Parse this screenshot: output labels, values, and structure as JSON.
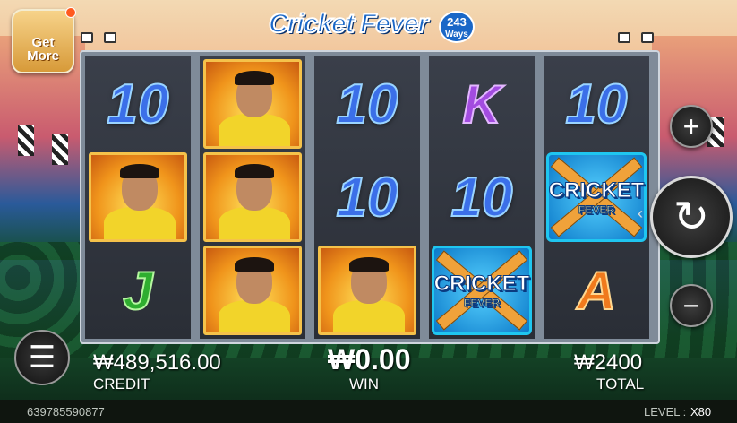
{
  "logo": {
    "title": "Cricket Fever",
    "ways_number": "243",
    "ways_label": "Ways"
  },
  "get_more": {
    "label_line1": "Get",
    "label_line2": "More"
  },
  "reels": [
    [
      {
        "type": "ten",
        "text": "10"
      },
      {
        "type": "captain"
      },
      {
        "type": "J",
        "text": "J"
      }
    ],
    [
      {
        "type": "captain"
      },
      {
        "type": "captain"
      },
      {
        "type": "captain"
      }
    ],
    [
      {
        "type": "ten",
        "text": "10"
      },
      {
        "type": "ten",
        "text": "10"
      },
      {
        "type": "captain"
      }
    ],
    [
      {
        "type": "K",
        "text": "K"
      },
      {
        "type": "ten",
        "text": "10"
      },
      {
        "type": "wild",
        "text1": "CRICKET",
        "text2": "FEVER"
      }
    ],
    [
      {
        "type": "ten",
        "text": "10"
      },
      {
        "type": "wild",
        "text1": "CRICKET",
        "text2": "FEVER"
      },
      {
        "type": "A",
        "text": "A"
      }
    ]
  ],
  "controls": {
    "plus_icon": "+",
    "minus_icon": "−",
    "spin_icon": "↻",
    "menu_icon": "☰",
    "collapse_icon": "‹"
  },
  "credit": {
    "value": "₩489,516.00",
    "label": "CREDIT"
  },
  "win": {
    "value": "₩0.00",
    "label": "WIN"
  },
  "total": {
    "value": "₩2400",
    "label": "TOTAL"
  },
  "footer": {
    "round_id": "639785590877",
    "level_label": "LEVEL :",
    "level_value": "X80"
  }
}
